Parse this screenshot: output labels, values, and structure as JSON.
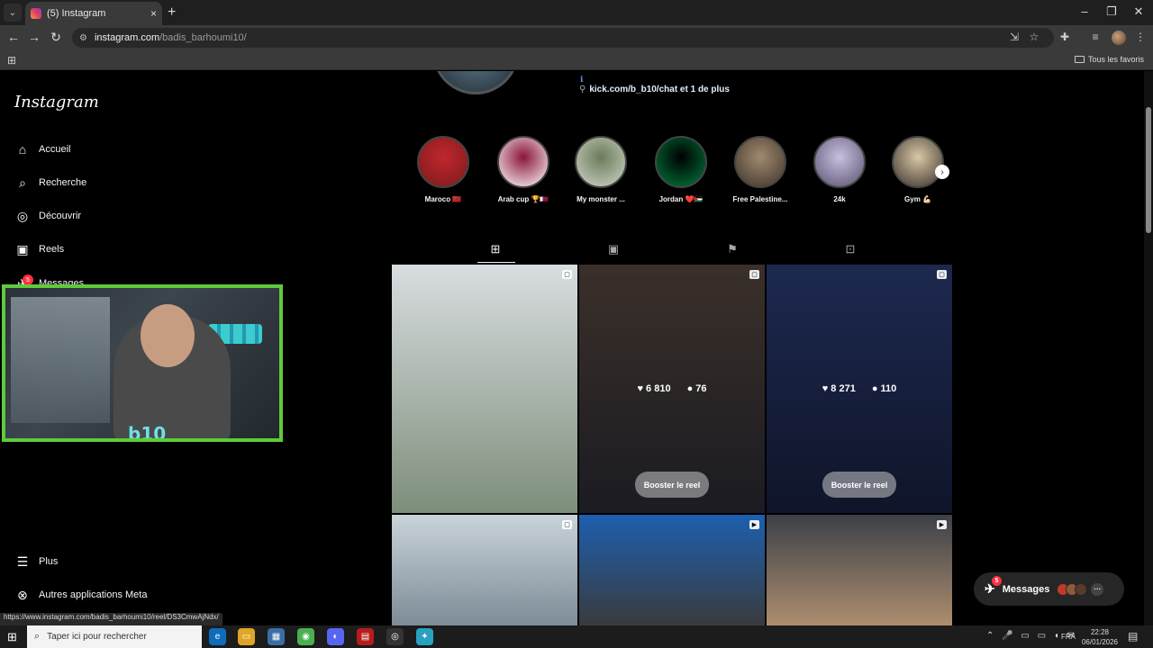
{
  "browser": {
    "tab_title": "(5) Instagram",
    "tab_close": "×",
    "new_tab": "+",
    "url_host": "instagram.com",
    "url_path": "/badis_barhoumi10/",
    "bookmarks_label": "Tous les favoris",
    "status_url": "https://www.instagram.com/badis_barhoumi10/reel/DS3CmwAjNdx/"
  },
  "sidebar": {
    "logo": "Instagram",
    "items": [
      {
        "label": "Accueil",
        "icon": "home-icon"
      },
      {
        "label": "Recherche",
        "icon": "search-icon"
      },
      {
        "label": "Découvrir",
        "icon": "compass-icon"
      },
      {
        "label": "Reels",
        "icon": "reels-icon"
      },
      {
        "label": "Messages",
        "icon": "messages-icon"
      },
      {
        "label": "Plus",
        "icon": "menu-icon"
      },
      {
        "label": "Autres applications Meta",
        "icon": "meta-apps-icon"
      }
    ],
    "messages_badge": "5"
  },
  "profile": {
    "link_info": "ℹ",
    "link_text": "kick.com/b_b10/chat et 1 de plus"
  },
  "highlights": [
    {
      "label": "Maroco 🇲🇦",
      "colors": [
        "#c1272d",
        "#7a1a1d"
      ]
    },
    {
      "label": "Arab cup 🏆🇶🇦",
      "colors": [
        "#8a1538",
        "#ffffff"
      ]
    },
    {
      "label": "My monster ...",
      "colors": [
        "#6b7b5a",
        "#cfd5c8"
      ]
    },
    {
      "label": "Jordan ❤️🇯🇴",
      "colors": [
        "#000000",
        "#007a3d"
      ]
    },
    {
      "label": "Free Palestine...",
      "colors": [
        "#a08a70",
        "#3e3328"
      ]
    },
    {
      "label": "24k",
      "colors": [
        "#c9c0e0",
        "#5a5070"
      ]
    },
    {
      "label": "Gym 💪🏻",
      "colors": [
        "#d8c8a8",
        "#3a3028"
      ]
    }
  ],
  "profile_tabs": [
    "posts-tab",
    "reels-tab",
    "saved-tab",
    "tagged-tab"
  ],
  "posts": [
    {
      "bg": [
        "#d8dde0",
        "#7d8e7a"
      ],
      "likes": "",
      "comments": "",
      "boost": "",
      "type_icon": "▢"
    },
    {
      "bg": [
        "#5a4a40",
        "#2a2a35"
      ],
      "likes": "6 810",
      "comments": "76",
      "boost": "Booster le reel",
      "type_icon": "▢"
    },
    {
      "bg": [
        "#2c3f7a",
        "#182040"
      ],
      "likes": "8 271",
      "comments": "110",
      "boost": "Booster le reel",
      "type_icon": "▢"
    },
    {
      "bg": [
        "#c9d3d9",
        "#7b8a96"
      ],
      "likes": "",
      "comments": "",
      "boost": "",
      "type_icon": "▢"
    },
    {
      "bg": [
        "#1d5fb0",
        "#3a3a3a"
      ],
      "likes": "",
      "comments": "",
      "boost": "",
      "type_icon": "▶"
    },
    {
      "bg": [
        "#3c4048",
        "#b09070"
      ],
      "likes": "",
      "comments": "",
      "boost": "",
      "type_icon": "▶"
    }
  ],
  "messages_pill": {
    "label": "Messages",
    "badge": "5",
    "more": "···"
  },
  "taskbar": {
    "search_placeholder": "Taper ici pour rechercher",
    "lang": "FRA",
    "time": "22:28",
    "date": "06/01/2026"
  },
  "webcam": {
    "logo": "b10"
  }
}
